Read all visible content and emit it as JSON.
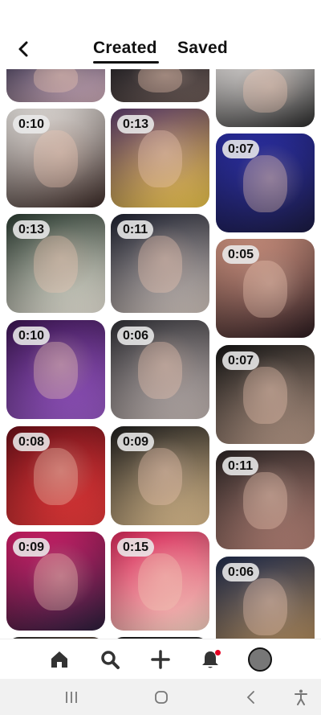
{
  "header": {
    "tabs": [
      {
        "label": "Created",
        "active": true
      },
      {
        "label": "Saved",
        "active": false
      }
    ]
  },
  "pins": [
    {
      "duration": "",
      "colors": [
        "#3a3550",
        "#c9a8b4"
      ]
    },
    {
      "duration": "",
      "colors": [
        "#1a1a1f",
        "#6b5a55"
      ]
    },
    {
      "duration": "",
      "colors": [
        "#ece8e6",
        "#2a2a2a"
      ]
    },
    {
      "duration": "0:10",
      "colors": [
        "#f0ece8",
        "#3a2a26"
      ]
    },
    {
      "duration": "0:13",
      "colors": [
        "#5a3b6a",
        "#e8c24a"
      ]
    },
    {
      "duration": "0:07",
      "colors": [
        "#2b2fa8",
        "#1a1a40"
      ]
    },
    {
      "duration": "0:13",
      "colors": [
        "#2a3a30",
        "#e8e4d8"
      ]
    },
    {
      "duration": "0:11",
      "colors": [
        "#1b1f2e",
        "#d0c4bc"
      ]
    },
    {
      "duration": "0:05",
      "colors": [
        "#d89a86",
        "#2a1a1e"
      ]
    },
    {
      "duration": "0:10",
      "colors": [
        "#3a1550",
        "#9a5ac8"
      ]
    },
    {
      "duration": "0:06",
      "colors": [
        "#2e2e34",
        "#c4b8b4"
      ]
    },
    {
      "duration": "0:07",
      "colors": [
        "#141414",
        "#b89a88"
      ]
    },
    {
      "duration": "0:08",
      "colors": [
        "#6a1018",
        "#e83a3a"
      ]
    },
    {
      "duration": "0:09",
      "colors": [
        "#1c1c1c",
        "#e0c090"
      ]
    },
    {
      "duration": "0:11",
      "colors": [
        "#2a2424",
        "#b88478"
      ]
    },
    {
      "duration": "0:09",
      "colors": [
        "#d81f6a",
        "#2a1e3a"
      ]
    },
    {
      "duration": "0:15",
      "colors": [
        "#d8285a",
        "#f4d0c0"
      ]
    },
    {
      "duration": "0:06",
      "colors": [
        "#1e2a4a",
        "#b48c58"
      ]
    },
    {
      "duration": "",
      "colors": [
        "#2a2a2a",
        "#8a6a50"
      ]
    },
    {
      "duration": "",
      "colors": [
        "#1a1a1a",
        "#4a4a4a"
      ]
    }
  ],
  "bottom_nav": {
    "items": [
      "home-icon",
      "search-icon",
      "add-icon",
      "notifications-icon",
      "profile-avatar"
    ],
    "notification_dot_color": "#e60023"
  },
  "system_nav": {
    "items": [
      "recent-apps-icon",
      "home-circle-icon",
      "back-icon",
      "accessibility-icon"
    ]
  }
}
